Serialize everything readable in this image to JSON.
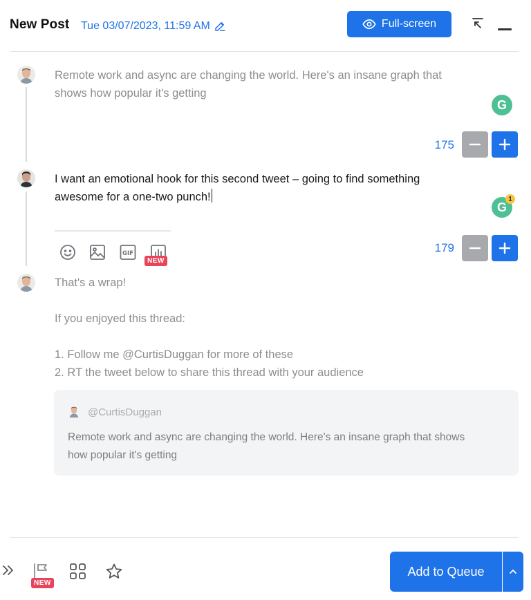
{
  "header": {
    "title": "New Post",
    "datetime": "Tue 03/07/2023, 11:59 AM",
    "fullscreen_label": "Full-screen"
  },
  "posts": [
    {
      "text_line1": "Remote work and async are changing the world. Here's an insane graph that",
      "text_line2": "shows how popular it's getting",
      "char_count": "175"
    },
    {
      "text_line1": "I want an emotional hook for this second tweet – going to find something",
      "text_line2": "awesome for a one-two punch!",
      "char_count": "179",
      "grammarly_badge": "1",
      "toolbar": {
        "icons": [
          "emoji-icon",
          "image-icon",
          "gif-icon",
          "poll-icon"
        ],
        "new_badge": "NEW"
      }
    },
    {
      "lines": [
        "That's a wrap!",
        "If you enjoyed this thread:",
        "1. Follow me @CurtisDuggan for more of these",
        "2. RT the tweet below to share this thread with your audience"
      ],
      "quote": {
        "handle": "@CurtisDuggan",
        "text_line1": "Remote work and async are changing the world. Here's an insane graph that shows",
        "text_line2": "how popular it's getting"
      }
    }
  ],
  "grammarly_letter": "G",
  "footer": {
    "new_badge": "NEW",
    "queue_label": "Add to Queue"
  },
  "colors": {
    "accent": "#1e73e8",
    "grammarly": "#4fc093",
    "new_badge": "#e8455a"
  }
}
